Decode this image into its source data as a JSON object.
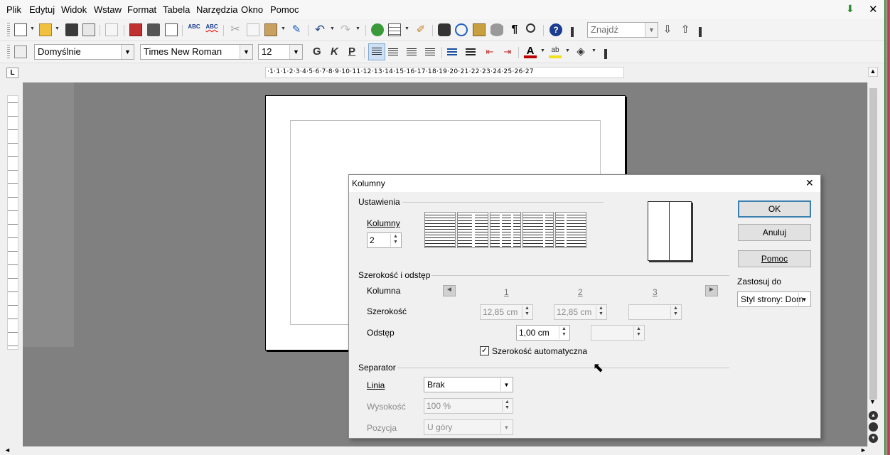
{
  "menubar": {
    "items": [
      "Plik",
      "Edytuj",
      "Widok",
      "Wstaw",
      "Format",
      "Tabela",
      "Narzędzia",
      "Okno",
      "Pomoc"
    ]
  },
  "toolbar": {
    "search_placeholder": "Znajdź"
  },
  "formatting": {
    "style": "Domyślnie",
    "font": "Times New Roman",
    "size": "12",
    "bold": "G",
    "italic": "K",
    "underline": "P"
  },
  "ruler": {
    "text": "·1·1·1·2·3·4·5·6·7·8·9·10·11·12·13·14·15·16·17·18·19·20·21·22·23·24·25·26·27"
  },
  "dialog": {
    "title": "Kolumny",
    "close": "✕",
    "settings_group": "Ustawienia",
    "columns_label": "Kolumny",
    "columns_value": "2",
    "width_spacing_group": "Szerokość i odstęp",
    "column_label": "Kolumna",
    "col1": "1",
    "col2": "2",
    "col3": "3",
    "width_label": "Szerokość",
    "width1": "12,85 cm",
    "width2": "12,85 cm",
    "spacing_label": "Odstęp",
    "spacing1": "1,00 cm",
    "auto_width_label": "Szerokość automatyczna",
    "separator_group": "Separator",
    "line_label": "Linia",
    "line_value": "Brak",
    "height_label": "Wysokość",
    "height_value": "100 %",
    "position_label": "Pozycja",
    "position_value": "U góry",
    "ok": "OK",
    "cancel": "Anuluj",
    "help": "Pomoc",
    "apply_to_label": "Zastosuj do",
    "apply_to_value": "Styl strony: Dom"
  }
}
